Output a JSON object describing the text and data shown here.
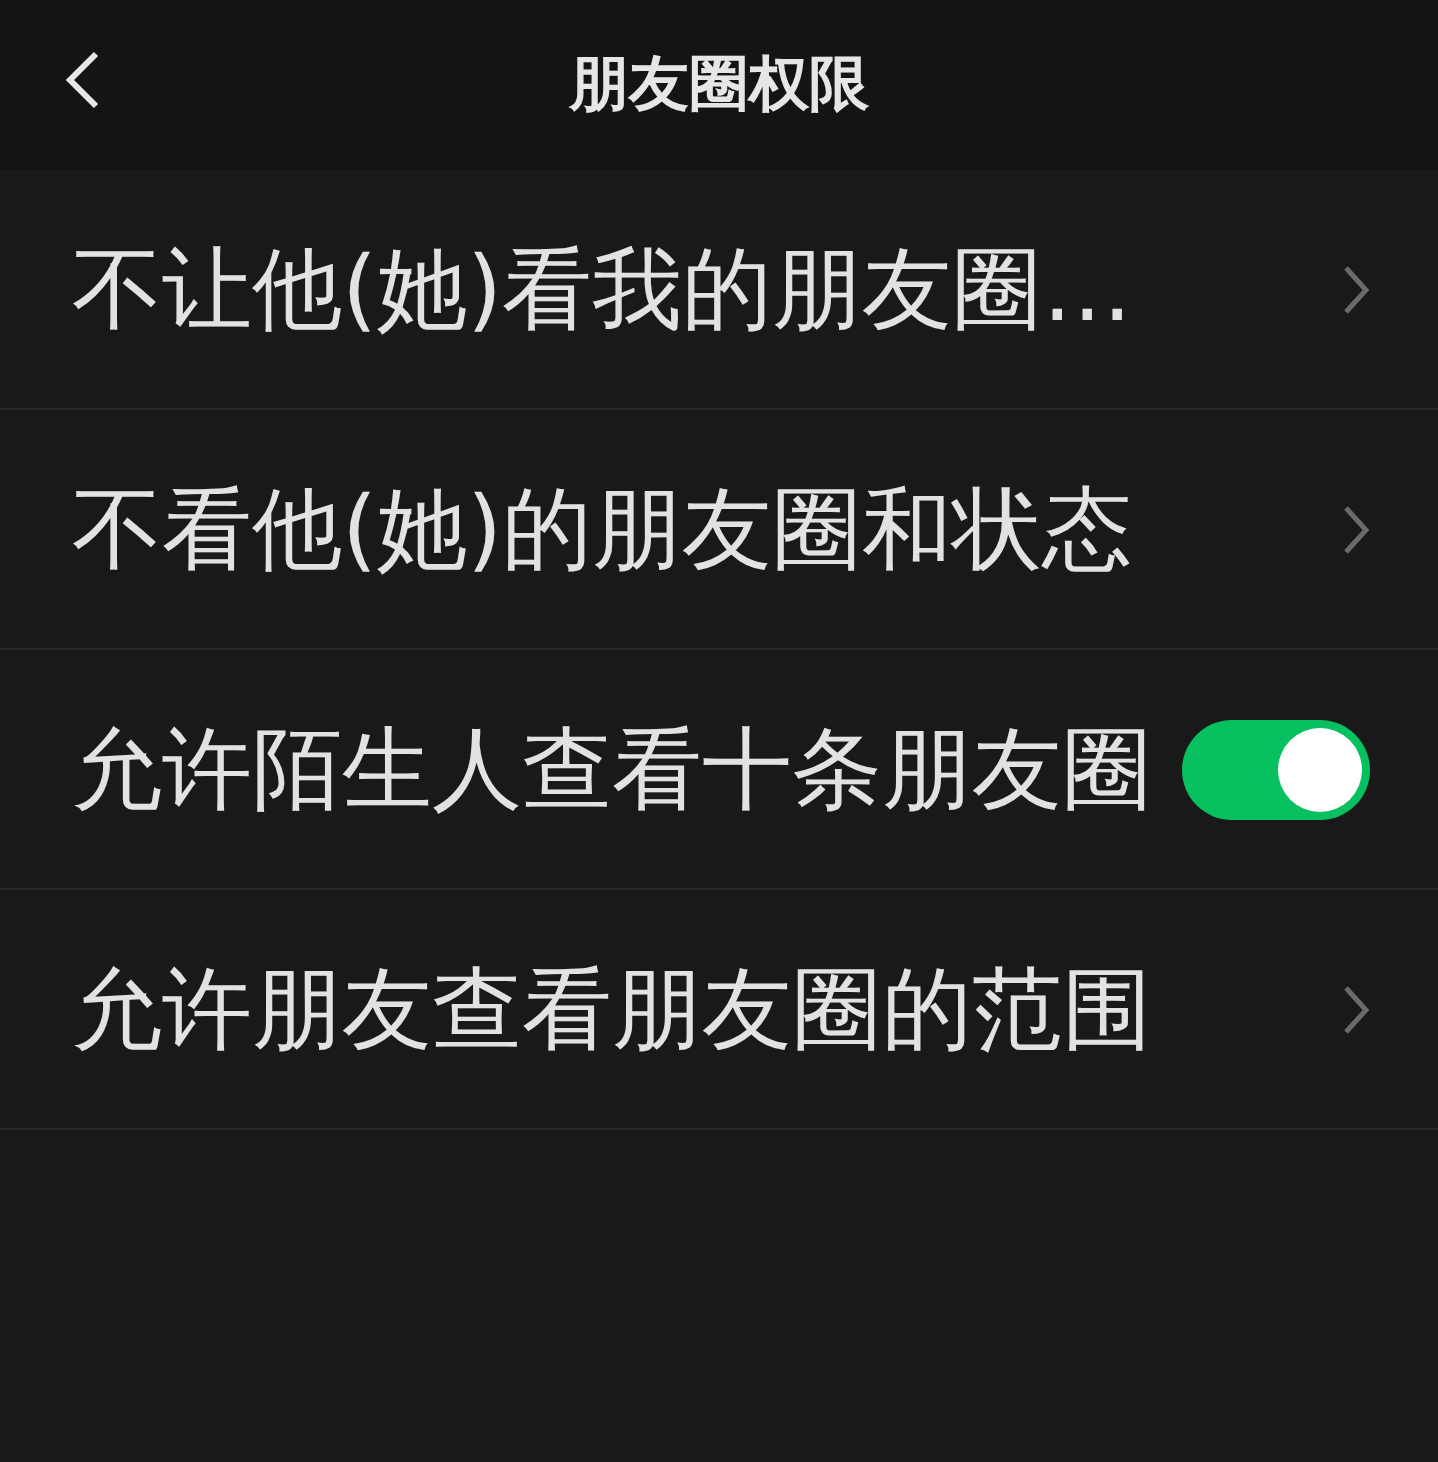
{
  "header": {
    "title": "朋友圈权限"
  },
  "rows": [
    {
      "kind": "link",
      "label": "不让他(她)看我的朋友圈…"
    },
    {
      "kind": "link",
      "label": "不看他(她)的朋友圈和状态"
    },
    {
      "kind": "toggle",
      "label": "允许陌生人查看十条朋友圈",
      "on": true
    },
    {
      "kind": "link",
      "label": "允许朋友查看朋友圈的范围"
    }
  ]
}
